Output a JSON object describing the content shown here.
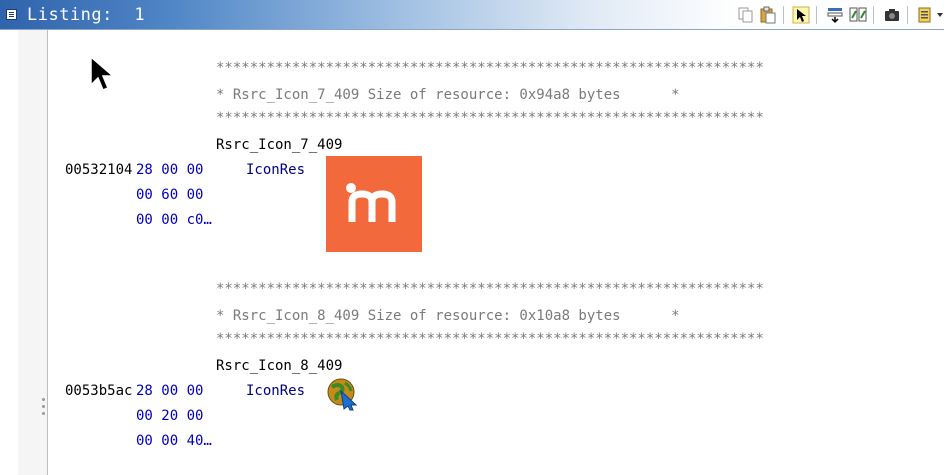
{
  "window": {
    "title": "Listing:  1"
  },
  "toolbar": {
    "buttons": [
      {
        "name": "copy-icon"
      },
      {
        "name": "paste-icon"
      },
      {
        "name": "cursor-select-icon"
      },
      {
        "name": "field-navigation-icon"
      },
      {
        "name": "diff-view-icon"
      },
      {
        "name": "snapshot-icon"
      },
      {
        "name": "edit-listing-fields-icon"
      }
    ]
  },
  "listing": {
    "blocks": [
      {
        "stars_top": "*****************************************************************",
        "comment": "* Rsrc_Icon_7_409 Size of resource: 0x94a8 bytes      *",
        "stars_bottom": "*****************************************************************",
        "label": "Rsrc_Icon_7_409",
        "address": "00532104",
        "bytes": [
          "28 00 00",
          "00 60 00",
          "00 00 c0…"
        ],
        "mnemonic": "IconRes",
        "preview_icon": "orange-m-logo-icon"
      },
      {
        "stars_top": "*****************************************************************",
        "comment": "* Rsrc_Icon_8_409 Size of resource: 0x10a8 bytes      *",
        "stars_bottom": "*****************************************************************",
        "label": "Rsrc_Icon_8_409",
        "address": "0053b5ac",
        "bytes": [
          "28 00 00",
          "00 20 00",
          "00 00 40…"
        ],
        "mnemonic": "IconRes",
        "preview_icon": "globe-arrow-icon"
      }
    ]
  },
  "colors": {
    "address": "#000000",
    "bytes": "#0000c0",
    "mnemonic": "#000080",
    "comment": "#7a7a7a",
    "icon_accent": "#f26a3b"
  }
}
